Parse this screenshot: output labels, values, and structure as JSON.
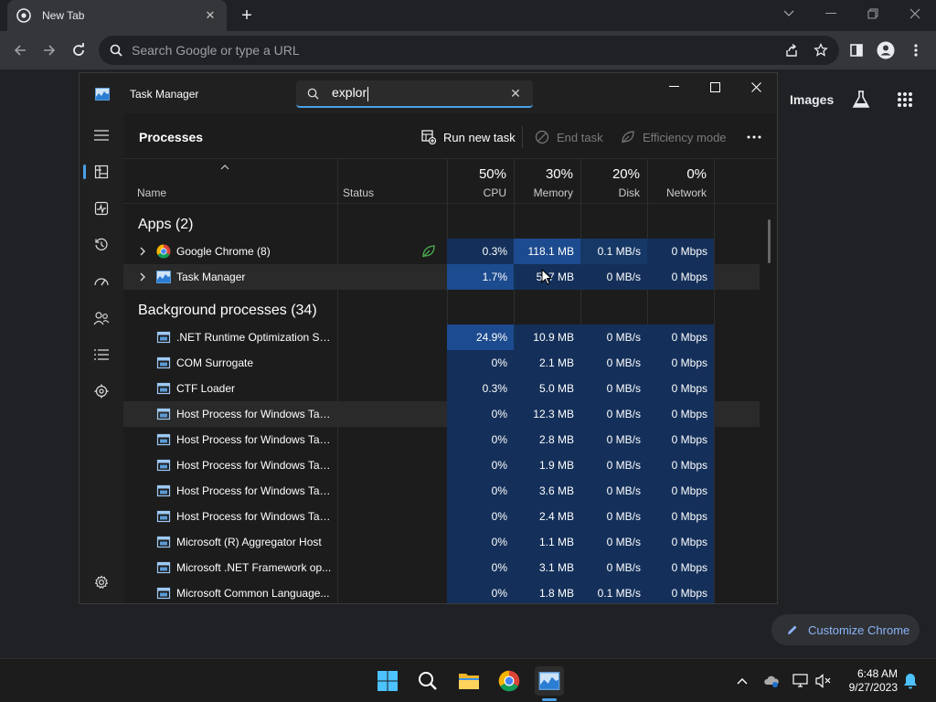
{
  "browser": {
    "tab_title": "New Tab",
    "omnibox_placeholder": "Search Google or type a URL",
    "images_link": "Images",
    "customize_label": "Customize Chrome"
  },
  "task_manager": {
    "window_title": "Task Manager",
    "search_value": "explor",
    "page_title": "Processes",
    "run_new_task": "Run new task",
    "end_task": "End task",
    "efficiency_mode": "Efficiency mode",
    "columns": {
      "name": "Name",
      "status": "Status",
      "cpu_pct": "50%",
      "cpu": "CPU",
      "mem_pct": "30%",
      "mem": "Memory",
      "disk_pct": "20%",
      "disk": "Disk",
      "net_pct": "0%",
      "net": "Network"
    },
    "apps_group": "Apps (2)",
    "bg_group": "Background processes (34)",
    "apps": [
      {
        "name": "Google Chrome (8)",
        "cpu": "0.3%",
        "mem": "118.1 MB",
        "disk": "0.1 MB/s",
        "net": "0 Mbps"
      },
      {
        "name": "Task Manager",
        "cpu": "1.7%",
        "mem": "5 .7 MB",
        "disk": "0 MB/s",
        "net": "0 Mbps"
      }
    ],
    "background": [
      {
        "name": ".NET Runtime Optimization Se...",
        "cpu": "24.9%",
        "mem": "10.9 MB",
        "disk": "0 MB/s",
        "net": "0 Mbps"
      },
      {
        "name": "COM Surrogate",
        "cpu": "0%",
        "mem": "2.1 MB",
        "disk": "0 MB/s",
        "net": "0 Mbps"
      },
      {
        "name": "CTF Loader",
        "cpu": "0.3%",
        "mem": "5.0 MB",
        "disk": "0 MB/s",
        "net": "0 Mbps"
      },
      {
        "name": "Host Process for Windows Tasks",
        "cpu": "0%",
        "mem": "12.3 MB",
        "disk": "0 MB/s",
        "net": "0 Mbps"
      },
      {
        "name": "Host Process for Windows Tasks",
        "cpu": "0%",
        "mem": "2.8 MB",
        "disk": "0 MB/s",
        "net": "0 Mbps"
      },
      {
        "name": "Host Process for Windows Tasks",
        "cpu": "0%",
        "mem": "1.9 MB",
        "disk": "0 MB/s",
        "net": "0 Mbps"
      },
      {
        "name": "Host Process for Windows Tasks",
        "cpu": "0%",
        "mem": "3.6 MB",
        "disk": "0 MB/s",
        "net": "0 Mbps"
      },
      {
        "name": "Host Process for Windows Tasks",
        "cpu": "0%",
        "mem": "2.4 MB",
        "disk": "0 MB/s",
        "net": "0 Mbps"
      },
      {
        "name": "Microsoft (R) Aggregator Host",
        "cpu": "0%",
        "mem": "1.1 MB",
        "disk": "0 MB/s",
        "net": "0 Mbps"
      },
      {
        "name": "Microsoft .NET Framework op...",
        "cpu": "0%",
        "mem": "3.1 MB",
        "disk": "0 MB/s",
        "net": "0 Mbps"
      },
      {
        "name": "Microsoft Common Language...",
        "cpu": "0%",
        "mem": "1.8 MB",
        "disk": "0.1 MB/s",
        "net": "0 Mbps"
      }
    ]
  },
  "taskbar": {
    "time": "6:48 AM",
    "date": "9/27/2023"
  }
}
